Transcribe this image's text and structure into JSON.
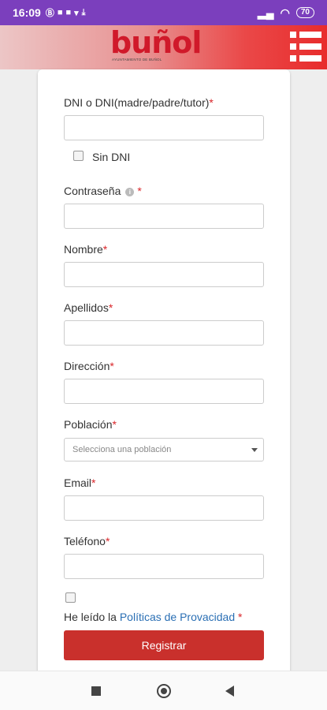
{
  "status_bar": {
    "time": "16:09",
    "battery": "70",
    "icons_left": [
      "notification-icon",
      "teams-icon",
      "teams-icon",
      "twitter-icon",
      "download-icon"
    ],
    "icons_right": [
      "signal-icon",
      "wifi-icon",
      "battery-icon"
    ]
  },
  "header": {
    "logo_text": "buñol",
    "logo_subtitle": "AYUNTAMIENTO DE BUÑOL",
    "brand_color": "#d0192a",
    "menu_icon": "hamburger-menu-icon"
  },
  "form": {
    "dni_label": "DNI o DNI(madre/padre/tutor)",
    "dni_value": "",
    "sin_dni_label": "Sin DNI",
    "sin_dni_checked": false,
    "password_label": "Contraseña",
    "password_value": "",
    "info_icon": "info-icon",
    "name_label": "Nombre",
    "name_value": "",
    "surname_label": "Apellidos",
    "surname_value": "",
    "address_label": "Dirección",
    "address_value": "",
    "town_label": "Población",
    "town_placeholder": "Selecciona una población",
    "email_label": "Email",
    "email_value": "",
    "phone_label": "Teléfono",
    "phone_value": "",
    "privacy_checked": false,
    "privacy_text": "He leído la",
    "privacy_link": "Políticas de Provacidad",
    "required_mark": "*",
    "submit_label": "Registrar",
    "submit_color": "#c9302c"
  },
  "nav_bar": {
    "icons": [
      "recents-square-icon",
      "home-circle-icon",
      "back-triangle-icon"
    ]
  }
}
